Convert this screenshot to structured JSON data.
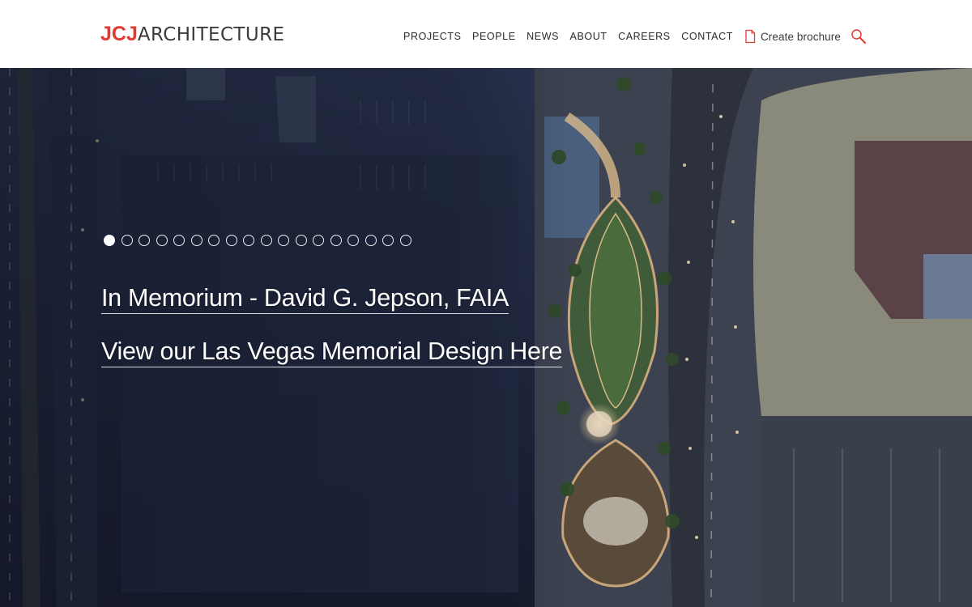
{
  "brand": {
    "mark": "JCJ",
    "word": "ARCHITECTURE",
    "accent_color": "#e23a30"
  },
  "nav": {
    "items": [
      {
        "label": "PROJECTS"
      },
      {
        "label": "PEOPLE"
      },
      {
        "label": "NEWS"
      },
      {
        "label": "ABOUT"
      },
      {
        "label": "CAREERS"
      },
      {
        "label": "CONTACT"
      }
    ],
    "brochure_label": "Create brochure",
    "brochure_icon": "document-icon",
    "search_icon": "search-icon"
  },
  "slider": {
    "total_slides": 18,
    "active_index": 0
  },
  "hero": {
    "headline_1": "In Memorium - David G. Jepson, FAIA",
    "headline_2": "View our Las Vegas Memorial Design Here"
  }
}
